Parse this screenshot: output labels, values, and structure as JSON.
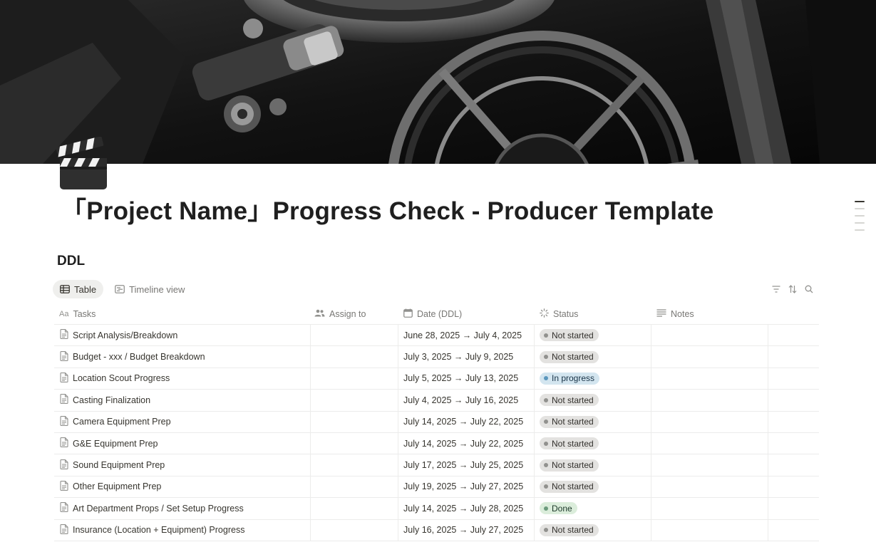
{
  "page": {
    "title": "「Project Name」Progress Check  - Producer Template",
    "icon": "clapperboard-icon"
  },
  "section": {
    "title": "DDL"
  },
  "views": [
    {
      "label": "Table",
      "icon": "table-icon",
      "active": true
    },
    {
      "label": "Timeline view",
      "icon": "timeline-icon",
      "active": false
    }
  ],
  "toolbar": {
    "icons": [
      "filter-icon",
      "sort-icon",
      "search-icon"
    ]
  },
  "table": {
    "columns": [
      {
        "label": "Tasks",
        "icon": "text-property-icon"
      },
      {
        "label": "Assign to",
        "icon": "people-icon"
      },
      {
        "label": "Date (DDL)",
        "icon": "calendar-icon"
      },
      {
        "label": "Status",
        "icon": "status-icon"
      },
      {
        "label": "Notes",
        "icon": "notes-lines-icon"
      }
    ],
    "rows": [
      {
        "task": "Script Analysis/Breakdown",
        "assign": "",
        "date": "June 28, 2025 → July 4, 2025",
        "status": "Not started",
        "notes": ""
      },
      {
        "task": "Budget - xxx / Budget Breakdown",
        "assign": "",
        "date": "July 3, 2025 → July 9, 2025",
        "status": "Not started",
        "notes": ""
      },
      {
        "task": "Location Scout Progress",
        "assign": "",
        "date": "July 5, 2025 → July 13, 2025",
        "status": "In progress",
        "notes": ""
      },
      {
        "task": "Casting Finalization",
        "assign": "",
        "date": "July 4, 2025 → July 16, 2025",
        "status": "Not started",
        "notes": ""
      },
      {
        "task": "Camera Equipment Prep",
        "assign": "",
        "date": "July 14, 2025 → July 22, 2025",
        "status": "Not started",
        "notes": ""
      },
      {
        "task": "G&E Equipment Prep",
        "assign": "",
        "date": "July 14, 2025 → July 22, 2025",
        "status": "Not started",
        "notes": ""
      },
      {
        "task": "Sound Equipment Prep",
        "assign": "",
        "date": "July 17, 2025 → July 25, 2025",
        "status": "Not started",
        "notes": ""
      },
      {
        "task": "Other Equipment Prep",
        "assign": "",
        "date": "July 19, 2025 → July 27, 2025",
        "status": "Not started",
        "notes": ""
      },
      {
        "task": "Art Department Props / Set Setup Progress",
        "assign": "",
        "date": "July 14, 2025 → July 28, 2025",
        "status": "Done",
        "notes": ""
      },
      {
        "task": "Insurance (Location + Equipment) Progress",
        "assign": "",
        "date": "July 16, 2025 → July 27, 2025",
        "status": "Not started",
        "notes": ""
      }
    ]
  },
  "status_colors": {
    "Not started": {
      "bg": "#e3e2e0",
      "dot": "#91918e",
      "text": "#32302c"
    },
    "In progress": {
      "bg": "#d3e5ef",
      "dot": "#5b97bd",
      "text": "#183347"
    },
    "Done": {
      "bg": "#dbeddb",
      "dot": "#6c9b7d",
      "text": "#1c3829"
    }
  }
}
